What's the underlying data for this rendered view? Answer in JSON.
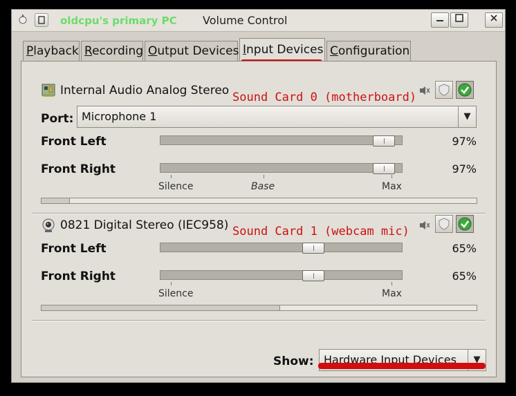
{
  "window": {
    "owner": "oldcpu's primary PC",
    "title": "Volume Control"
  },
  "tabs": [
    {
      "label": "Playback",
      "mnemonic": "P",
      "rest": "layback"
    },
    {
      "label": "Recording",
      "mnemonic": "R",
      "rest": "ecording"
    },
    {
      "label": "Output Devices",
      "mnemonic": "O",
      "rest": "utput Devices"
    },
    {
      "label": "Input Devices",
      "mnemonic": "I",
      "rest": "nput Devices"
    },
    {
      "label": "Configuration",
      "mnemonic": "C",
      "rest": "onfiguration"
    }
  ],
  "active_tab": "Input Devices",
  "devices": [
    {
      "name": "Internal Audio Analog Stereo",
      "icon": "audio-card-icon",
      "annotation": "Sound Card 0 (motherboard)",
      "port_label": "Port:",
      "port_value": "Microphone 1",
      "channels": [
        {
          "label": "Front Left",
          "value": 0.97,
          "percent": "97%"
        },
        {
          "label": "Front Right",
          "value": 0.97,
          "percent": "97%"
        }
      ],
      "ticks": [
        "Silence",
        "Base",
        "Max"
      ],
      "peak_level": 0.07
    },
    {
      "name": "0821 Digital Stereo (IEC958)",
      "icon": "webcam-icon",
      "annotation": "Sound Card 1 (webcam mic)",
      "channels": [
        {
          "label": "Front Left",
          "value": 0.65,
          "percent": "65%"
        },
        {
          "label": "Front Right",
          "value": 0.65,
          "percent": "65%"
        }
      ],
      "ticks": [
        "Silence",
        "Max"
      ],
      "peak_level": 0.55
    }
  ],
  "show": {
    "label": "Show:",
    "value": "Hardware Input Devices"
  },
  "colors": {
    "annotation": "#cc1111",
    "owner_label": "#6bdc6b",
    "underline": "#d10d0d"
  }
}
